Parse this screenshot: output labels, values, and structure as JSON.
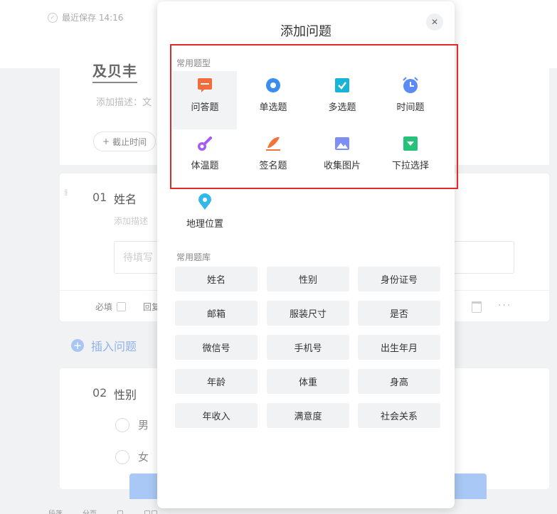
{
  "background": {
    "save_status": "最近保存 14:16",
    "form_title": "及贝丰",
    "form_desc": "添加描述：文",
    "deadline_label": "截止时间",
    "q1": {
      "num": "01",
      "label": "姓名",
      "desc": "添加描述",
      "placeholder": "待填写",
      "required": "必填",
      "repeat": "回复",
      "more": "···"
    },
    "insert_label": "插入问题",
    "q2": {
      "num": "02",
      "label": "性别",
      "options": [
        "男",
        "女"
      ]
    },
    "bottom_bits": [
      "段落",
      "分页",
      "口",
      "口口"
    ]
  },
  "modal": {
    "title": "添加问题",
    "close": "✕",
    "common_types_title": "常用题型",
    "types": [
      {
        "label": "问答题",
        "icon": "qa-icon",
        "color": "#f26d3d"
      },
      {
        "label": "单选题",
        "icon": "radio-icon",
        "color": "#3b8df2"
      },
      {
        "label": "多选题",
        "icon": "checkbox-icon",
        "color": "#1ab3d8"
      },
      {
        "label": "时间题",
        "icon": "clock-icon",
        "color": "#5b8cf5"
      },
      {
        "label": "体温题",
        "icon": "thermometer-icon",
        "color": "#a35cf0"
      },
      {
        "label": "签名题",
        "icon": "signature-icon",
        "color": "#f2733b"
      },
      {
        "label": "收集图片",
        "icon": "image-icon",
        "color": "#7d8ef5"
      },
      {
        "label": "下拉选择",
        "icon": "dropdown-icon",
        "color": "#27c27a"
      },
      {
        "label": "地理位置",
        "icon": "location-icon",
        "color": "#33b8ea"
      }
    ],
    "library_title": "常用题库",
    "library": [
      "姓名",
      "性别",
      "身份证号",
      "邮箱",
      "服装尺寸",
      "是否",
      "微信号",
      "手机号",
      "出生年月",
      "年龄",
      "体重",
      "身高",
      "年收入",
      "满意度",
      "社会关系"
    ]
  }
}
